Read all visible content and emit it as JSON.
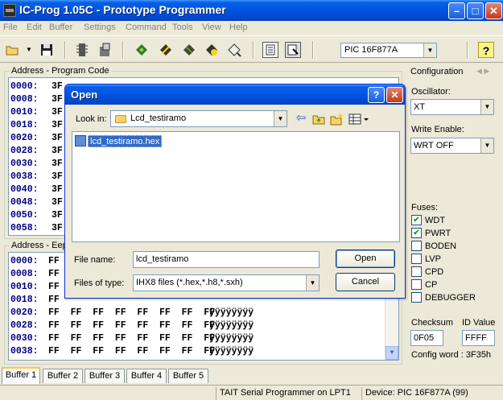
{
  "window": {
    "title": "IC-Prog 1.05C - Prototype Programmer",
    "min_glyph": "–",
    "max_glyph": "□",
    "close_glyph": "✕"
  },
  "menu": [
    "File",
    "Edit",
    "Buffer",
    "Settings",
    "Command",
    "Tools",
    "View",
    "Help"
  ],
  "toolbar": {
    "device": "PIC 16F877A",
    "icons": [
      "open-folder-icon",
      "save-icon",
      "chip-read-icon",
      "chip-program-icon",
      "read-device-icon",
      "program-device-icon",
      "erase-device-icon",
      "verify-device-icon",
      "blank-check-icon",
      "config-a-icon",
      "config-b-icon",
      "help-icon"
    ],
    "help_glyph": "?"
  },
  "program_code": {
    "label": "Address - Program Code",
    "rows": [
      {
        "addr": "0000:",
        "bytes": "3F"
      },
      {
        "addr": "0008:",
        "bytes": "3F"
      },
      {
        "addr": "0010:",
        "bytes": "3F"
      },
      {
        "addr": "0018:",
        "bytes": "3F"
      },
      {
        "addr": "0020:",
        "bytes": "3F"
      },
      {
        "addr": "0028:",
        "bytes": "3F"
      },
      {
        "addr": "0030:",
        "bytes": "3F"
      },
      {
        "addr": "0038:",
        "bytes": "3F"
      },
      {
        "addr": "0040:",
        "bytes": "3F"
      },
      {
        "addr": "0048:",
        "bytes": "3F"
      },
      {
        "addr": "0050:",
        "bytes": "3F"
      },
      {
        "addr": "0058:",
        "bytes": "3F"
      }
    ]
  },
  "eeprom": {
    "label": "Address - Eep",
    "rows": [
      {
        "addr": "0000:",
        "bytes": "FF",
        "ascii": ""
      },
      {
        "addr": "0008:",
        "bytes": "FF",
        "ascii": ""
      },
      {
        "addr": "0010:",
        "bytes": "FF",
        "ascii": ""
      },
      {
        "addr": "0018:",
        "bytes": "FF",
        "ascii": ""
      },
      {
        "addr": "0020:",
        "bytes": "FF  FF  FF  FF  FF  FF  FF  FF",
        "ascii": "ÿÿÿÿÿÿÿÿ"
      },
      {
        "addr": "0028:",
        "bytes": "FF  FF  FF  FF  FF  FF  FF  FF",
        "ascii": "ÿÿÿÿÿÿÿÿ"
      },
      {
        "addr": "0030:",
        "bytes": "FF  FF  FF  FF  FF  FF  FF  FF",
        "ascii": "ÿÿÿÿÿÿÿÿ"
      },
      {
        "addr": "0038:",
        "bytes": "FF  FF  FF  FF  FF  FF  FF  FF",
        "ascii": "ÿÿÿÿÿÿÿÿ"
      }
    ]
  },
  "config": {
    "title": "Configuration",
    "oscillator_label": "Oscillator:",
    "oscillator": "XT",
    "write_enable_label": "Write Enable:",
    "write_enable": "WRT OFF",
    "fuses_label": "Fuses:",
    "fuses": [
      {
        "name": "WDT",
        "checked": true,
        "mark": "✔"
      },
      {
        "name": "PWRT",
        "checked": true,
        "mark": "✔"
      },
      {
        "name": "BODEN",
        "checked": false,
        "mark": ""
      },
      {
        "name": "LVP",
        "checked": false,
        "mark": ""
      },
      {
        "name": "CPD",
        "checked": false,
        "mark": ""
      },
      {
        "name": "CP",
        "checked": false,
        "mark": ""
      },
      {
        "name": "DEBUGGER",
        "checked": false,
        "mark": ""
      }
    ],
    "checksum_label": "Checksum",
    "checksum": "0F05",
    "id_label": "ID Value",
    "id_value": "FFFF",
    "config_word": "Config word : 3F35h"
  },
  "tabs": [
    "Buffer 1",
    "Buffer 2",
    "Buffer 3",
    "Buffer 4",
    "Buffer 5"
  ],
  "status": {
    "programmer": "TAIT  Serial  Programmer on LPT1",
    "device": "Device: PIC 16F877A   (99)"
  },
  "dialog": {
    "title": "Open",
    "help_glyph": "?",
    "close_glyph": "✕",
    "look_in_label": "Look in:",
    "look_in": "Lcd_testiramo",
    "files": [
      "lcd_testiramo.hex"
    ],
    "file_name_label": "File name:",
    "file_name": "lcd_testiramo",
    "file_type_label": "Files of type:",
    "file_type": "IHX8 files (*.hex,*.h8,*.sxh)",
    "open_button": "Open",
    "cancel_button": "Cancel"
  },
  "colors": {
    "titlebar": "#0054e3",
    "selection": "#316ac5",
    "address_text": "#000080"
  }
}
